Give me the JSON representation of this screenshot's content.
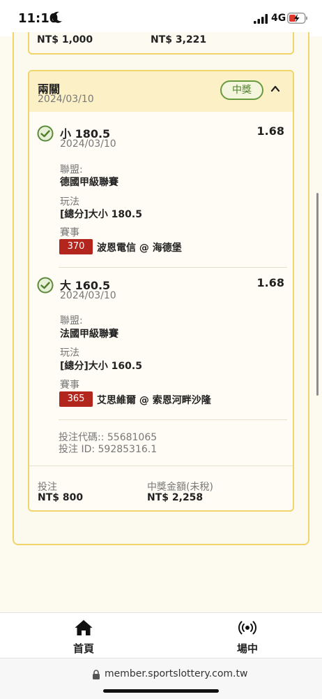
{
  "status_bar": {
    "time": "11:10",
    "network": "4G"
  },
  "previous_bet": {
    "stake": "NT$ 1,000",
    "payout": "NT$ 3,221"
  },
  "bet": {
    "type": "兩關",
    "date": "2024/03/10",
    "status_badge": "中獎",
    "selections": [
      {
        "title": "小 180.5",
        "date": "2024/03/10",
        "odds": "1.68",
        "league_label": "聯盟:",
        "league": "德國甲級聯賽",
        "market_label": "玩法",
        "market": "[總分]大小 180.5",
        "event_label": "賽事",
        "match_no": "370",
        "match": "波恩電信 @ 海德堡"
      },
      {
        "title": "大 160.5",
        "date": "2024/03/10",
        "odds": "1.68",
        "league_label": "聯盟:",
        "league": "法國甲級聯賽",
        "market_label": "玩法",
        "market": "[總分]大小 160.5",
        "event_label": "賽事",
        "match_no": "365",
        "match": "艾思維爾 @ 索恩河畔沙隆"
      }
    ],
    "bet_code_line": "投注代碼:: 55681065",
    "bet_id_line": "投注 ID: 59285316.1",
    "stake_label": "投注",
    "stake": "NT$ 800",
    "payout_label": "中獎金額(未稅)",
    "payout": "NT$ 2,258"
  },
  "tabs": [
    {
      "label": "首頁",
      "icon": "home-icon"
    },
    {
      "label": "場中",
      "icon": "live-broadcast-icon"
    }
  ],
  "url": "member.sportslottery.com.tw",
  "colors": {
    "accent_border": "#f1d56a",
    "header_bg": "#fcf1c6",
    "win_green": "#4f7f2a",
    "match_red": "#b3261e"
  }
}
